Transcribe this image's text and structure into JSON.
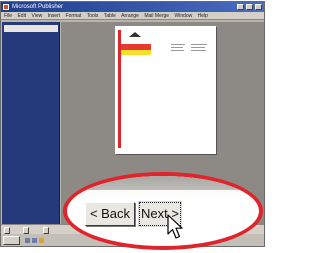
{
  "window": {
    "title": "Microsoft Publisher",
    "menu": [
      "File",
      "Edit",
      "View",
      "Insert",
      "Format",
      "Tools",
      "Table",
      "Arrange",
      "Mail Merge",
      "Window",
      "Help"
    ]
  },
  "task_pane": {
    "header": "",
    "lines": []
  },
  "status_bar": {
    "buttons": []
  },
  "zoom": {
    "back_label": "< Back",
    "next_label": "Next >"
  },
  "icons": {
    "cursor": "arrow-pointer-icon",
    "start": "windows-start-icon"
  },
  "colors": {
    "highlight_ring": "#e0242c",
    "page_accent_red": "#e53a2e",
    "page_accent_yellow": "#f3df2c",
    "task_pane": "#243a7a"
  }
}
